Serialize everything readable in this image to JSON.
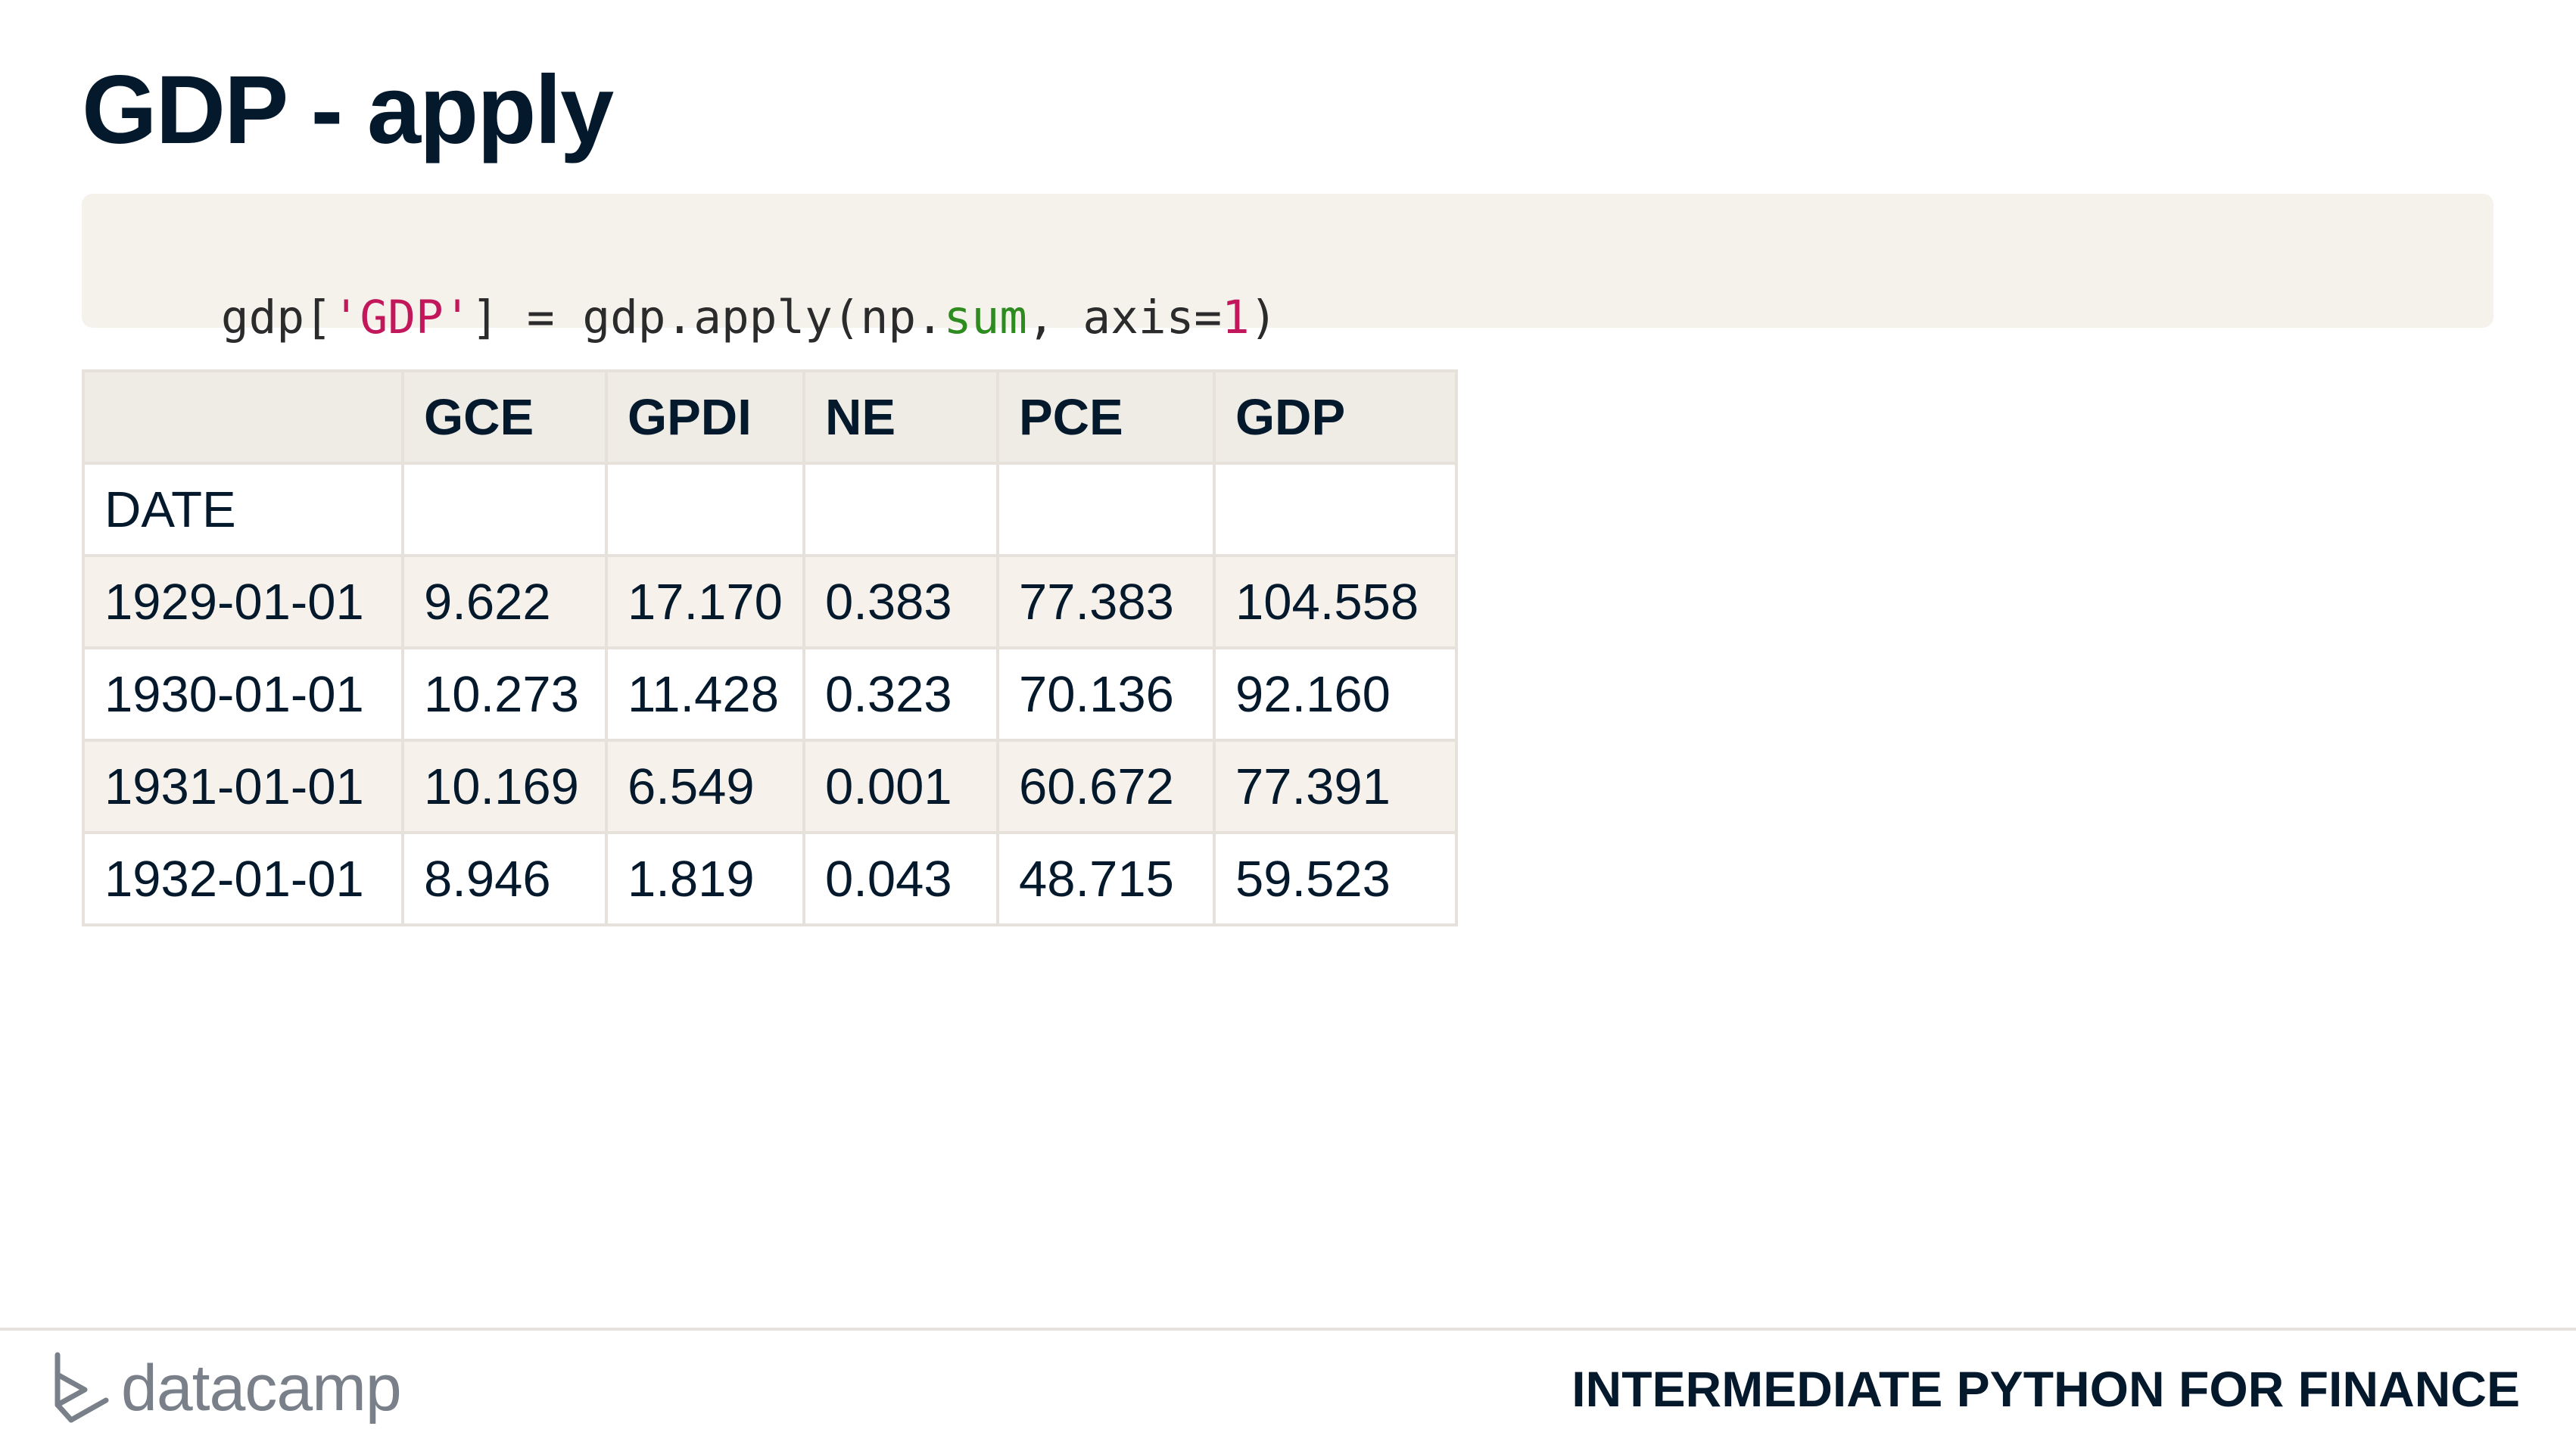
{
  "slide": {
    "title": "GDP - apply"
  },
  "code": {
    "tokens": [
      {
        "text": "gdp[",
        "kind": "plain"
      },
      {
        "text": "'GDP'",
        "kind": "string"
      },
      {
        "text": "] = gdp.apply(np.",
        "kind": "plain"
      },
      {
        "text": "sum",
        "kind": "function"
      },
      {
        "text": ", axis=",
        "kind": "plain"
      },
      {
        "text": "1",
        "kind": "number"
      },
      {
        "text": ")",
        "kind": "plain"
      }
    ]
  },
  "table": {
    "columns": [
      "",
      "GCE",
      "GPDI",
      "NE",
      "PCE",
      "GDP"
    ],
    "index_name": "DATE",
    "rows": [
      [
        "1929-01-01",
        "9.622",
        "17.170",
        "0.383",
        "77.383",
        "104.558"
      ],
      [
        "1930-01-01",
        "10.273",
        "11.428",
        "0.323",
        "70.136",
        "92.160"
      ],
      [
        "1931-01-01",
        "10.169",
        "6.549",
        "0.001",
        "60.672",
        "77.391"
      ],
      [
        "1932-01-01",
        "8.946",
        "1.819",
        "0.043",
        "48.715",
        "59.523"
      ]
    ]
  },
  "footer": {
    "logo_text": "datacamp",
    "course_title": "INTERMEDIATE PYTHON FOR FINANCE"
  },
  "colors": {
    "text": "#05192d",
    "code_background": "#f5f2ec",
    "string": "#c2185b",
    "function": "#2e8b1f",
    "number": "#c2185b",
    "table_border": "#e6e2db"
  }
}
